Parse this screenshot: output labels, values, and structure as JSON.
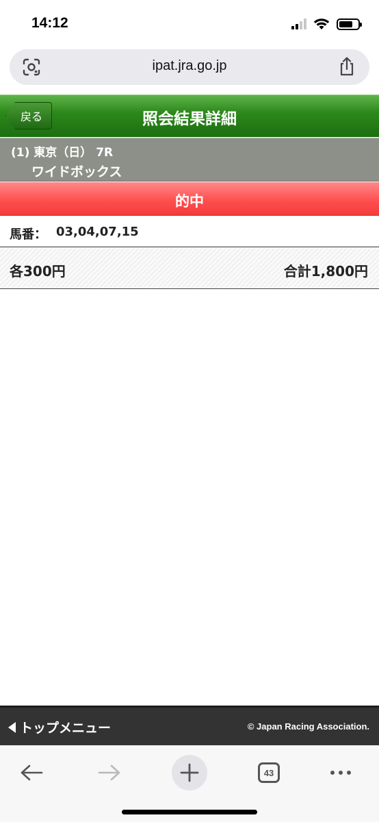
{
  "status_bar": {
    "time": "14:12",
    "icons": [
      "signal-icon",
      "wifi-icon",
      "battery-icon"
    ]
  },
  "browser": {
    "url": "ipat.jra.go.jp",
    "tab_count": "43",
    "icons": [
      "lens-icon",
      "share-icon",
      "back-arrow-icon",
      "forward-arrow-icon",
      "new-tab-icon",
      "tabs-icon",
      "more-icon"
    ]
  },
  "header": {
    "back_label": "戻る",
    "title": "照会結果詳細",
    "color": "#2e8a1c"
  },
  "race": {
    "line1": "(1) 東京（日） 7R",
    "line2": "ワイドボックス"
  },
  "result": {
    "label": "的中",
    "color": "#ff4f4f"
  },
  "bet": {
    "horses_label": "馬番：",
    "horses_value": "03,04,07,15",
    "each_amount": "各300円",
    "total_amount": "合計1,800円"
  },
  "footer": {
    "top_menu": "トップメニュー",
    "copyright": "© Japan Racing Association."
  }
}
